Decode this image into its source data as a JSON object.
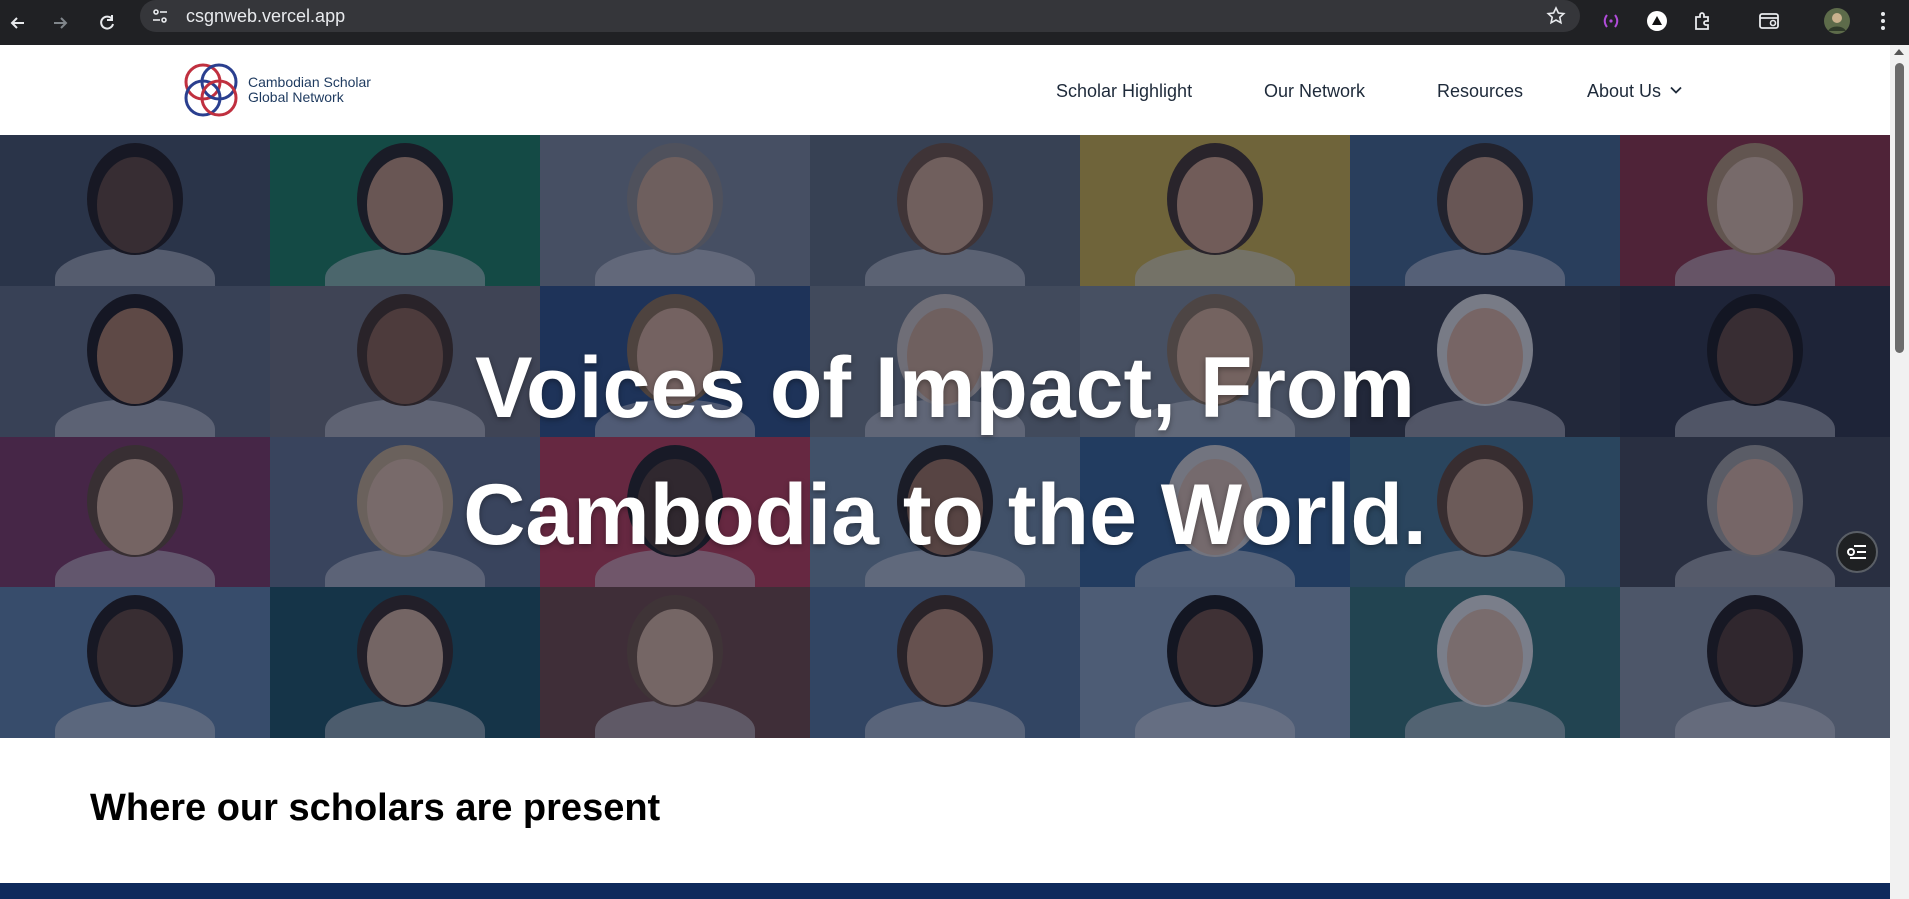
{
  "browser": {
    "url": "csgnweb.vercel.app",
    "icons": [
      "back-icon",
      "forward-icon",
      "reload-icon",
      "site-info-icon",
      "star-icon",
      "extension-purple-icon",
      "extension-triangle-icon",
      "extensions-puzzle-icon",
      "tab-search-icon",
      "profile-avatar-icon",
      "menu-kebab-icon"
    ]
  },
  "header": {
    "logo_line1": "Cambodian Scholar",
    "logo_line2": "Global Network",
    "nav": [
      {
        "label": "Scholar Highlight"
      },
      {
        "label": "Our Network"
      },
      {
        "label": "Resources"
      },
      {
        "label": "About Us"
      }
    ]
  },
  "hero": {
    "line1": "Voices of Impact, From",
    "line2": "Cambodia to the World.",
    "tile_colors": [
      [
        "#3d4a5c",
        "#0d7a52",
        "#7b8594",
        "#5a6674",
        "#d6b43a",
        "#3b5f86",
        "#8f2436"
      ],
      [
        "#5b6778",
        "#6a6e76",
        "#23487e",
        "#6f7a85",
        "#7d8792",
        "#2b2f3b",
        "#232636"
      ],
      [
        "#7a2b57",
        "#5d6d88",
        "#c2304b",
        "#6f8aa3",
        "#2b5b8f",
        "#3d6f8a",
        "#3b3f4a"
      ],
      [
        "#5a7fa6",
        "#0f4a5a",
        "#6b3d36",
        "#4f6f95",
        "#8aa3bd",
        "#2b6e6e",
        "#8b96a3"
      ]
    ],
    "skin_tones": [
      [
        "#5a3b2a",
        "#c89674",
        "#d3a98a",
        "#d8a888",
        "#d9a27f",
        "#c69576",
        "#e7c1a4"
      ],
      [
        "#b07956",
        "#8a5a3e",
        "#e0b090",
        "#d6aa8d",
        "#e1b18f",
        "#e6b79a",
        "#5b3a2c"
      ],
      [
        "#e2b495",
        "#e8c2a4",
        "#4a3022",
        "#a06d4e",
        "#e2c2ab",
        "#cf9f7f",
        "#e5b99e"
      ],
      [
        "#5b3a28",
        "#e1b597",
        "#e3b89a",
        "#c08b68",
        "#6a4330",
        "#ebc5ab",
        "#4a2d1f"
      ]
    ],
    "hair_tones": [
      [
        "#120c09",
        "#1a1410",
        "#8e8a86",
        "#6a4a33",
        "#3a2719",
        "#2c2520",
        "#b8926a"
      ],
      [
        "#0f0b09",
        "#3a2415",
        "#8c6a46",
        "#d6c9c0",
        "#8a7050",
        "#e8e6e2",
        "#0b0807"
      ],
      [
        "#5b3f2a",
        "#c9ad86",
        "#151010",
        "#1a1410",
        "#dcd8d2",
        "#5a3a25",
        "#a7a29c"
      ],
      [
        "#120c09",
        "#2a1c14",
        "#6a4a33",
        "#3a2416",
        "#0b0706",
        "#eeeeec",
        "#120c09"
      ]
    ],
    "menu_icon": "list-settings-icon"
  },
  "section": {
    "title": "Where our scholars are present"
  },
  "colors": {
    "chrome_bg": "#202124",
    "nav_text": "#1e2a3a",
    "logo_red": "#c0303f",
    "logo_blue": "#2a3f8f",
    "band_blue": "#0f2a5c"
  }
}
